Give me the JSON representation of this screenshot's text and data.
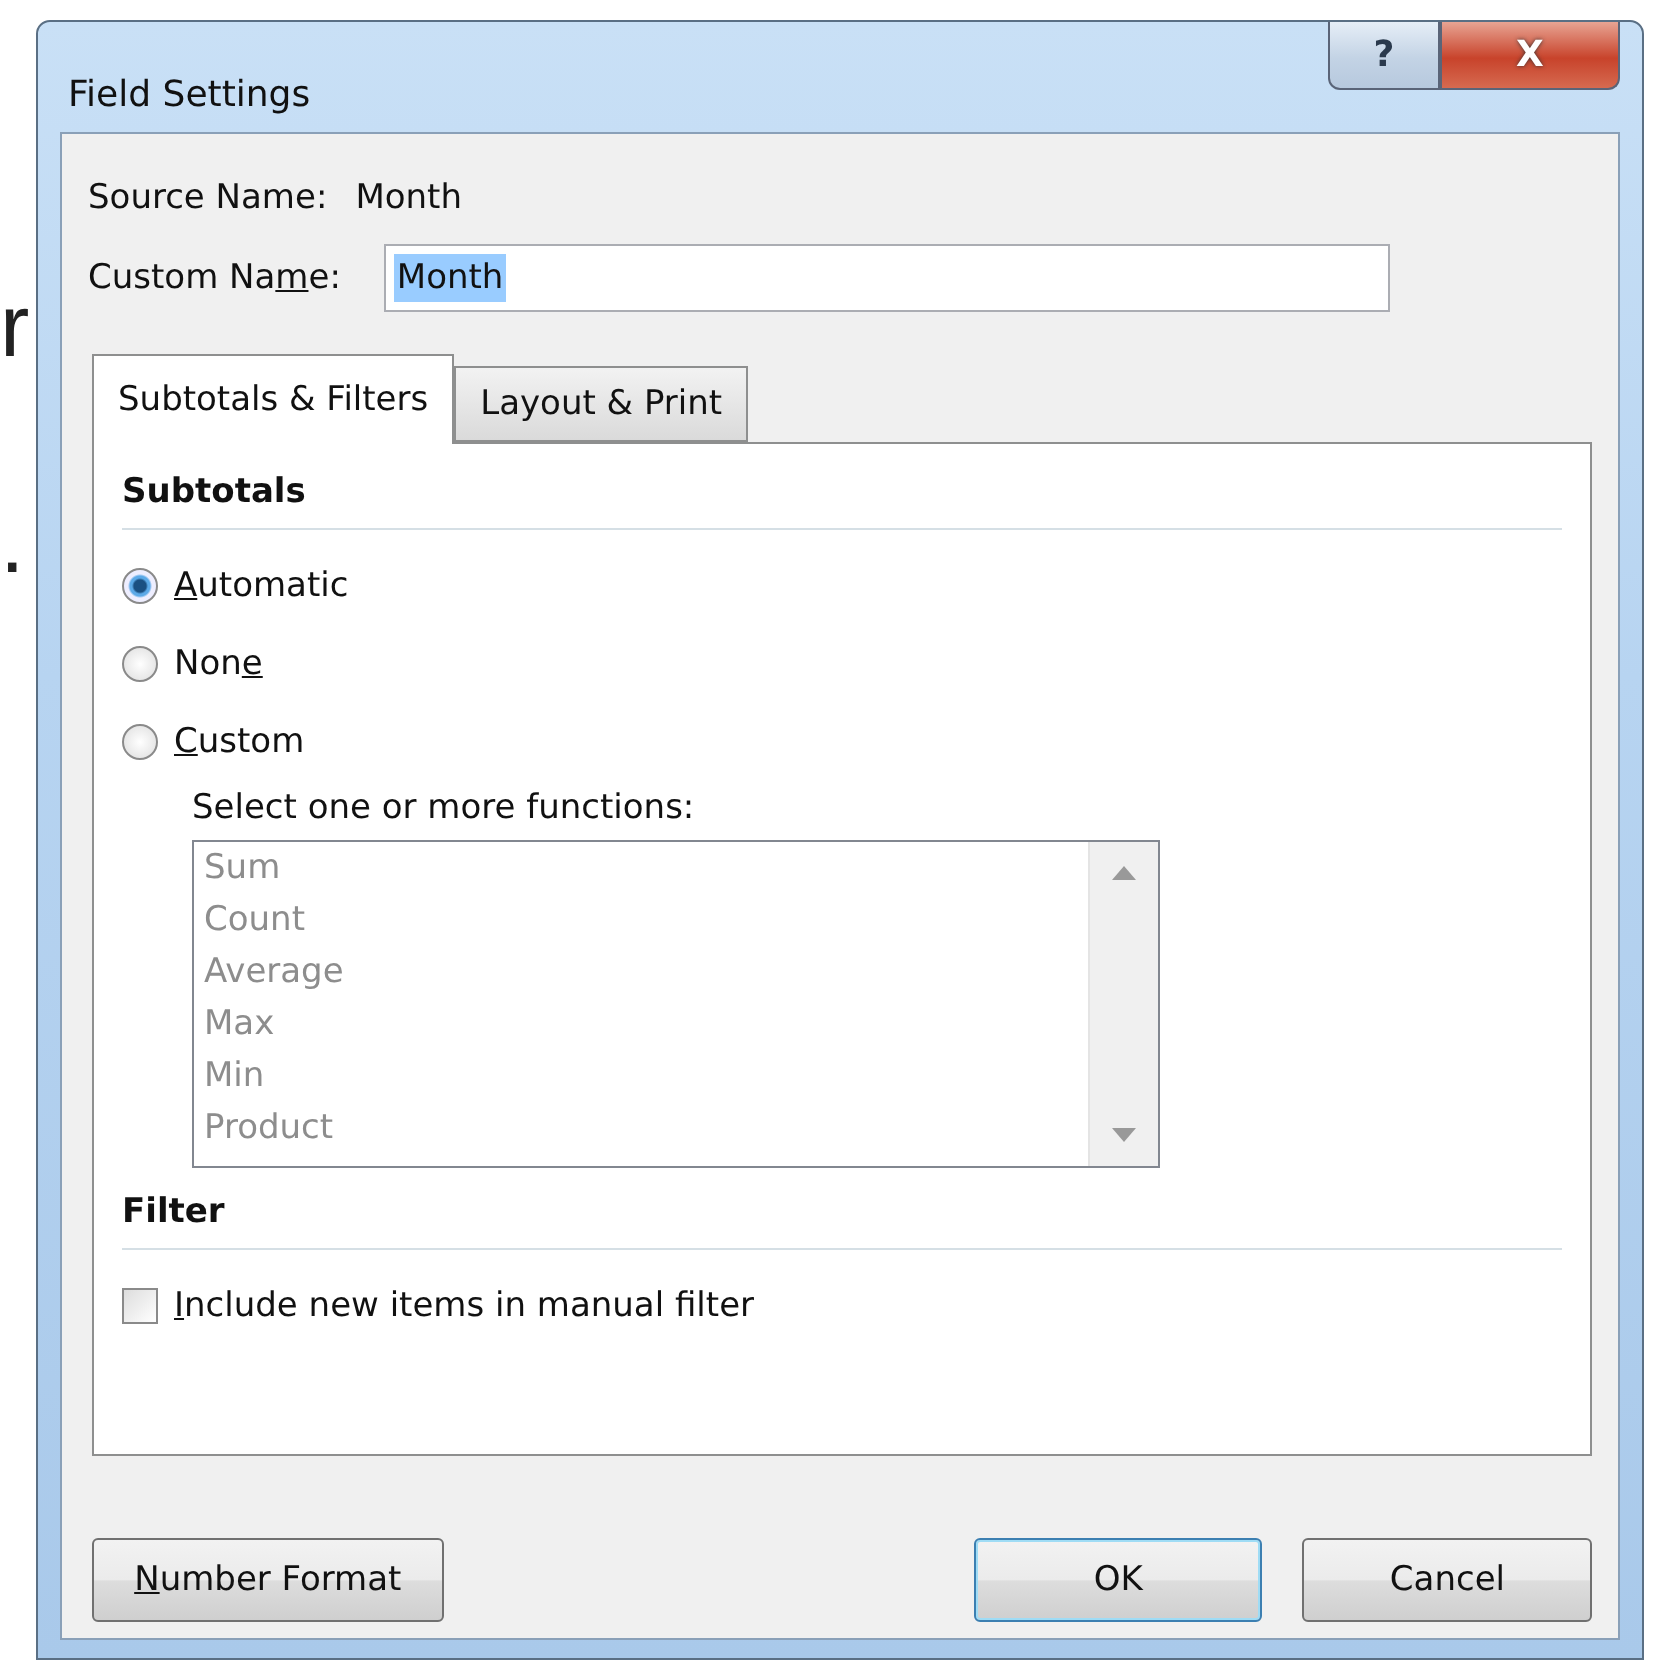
{
  "background_text": [
    "r",
    "."
  ],
  "window": {
    "title": "Field Settings",
    "help_button": "?",
    "close_button": "X"
  },
  "source_name": {
    "label": "Source Name:",
    "value": "Month"
  },
  "custom_name": {
    "label": {
      "before": "Custom Na",
      "key": "m",
      "after": "e:"
    },
    "value": "Month",
    "value_selected": true
  },
  "tabs": [
    {
      "label": "Subtotals & Filters",
      "selected": true
    },
    {
      "label": "Layout & Print",
      "selected": false
    }
  ],
  "subtotals": {
    "heading": "Subtotals",
    "options": [
      {
        "label": {
          "key": "A",
          "after": "utomatic"
        },
        "selected": true
      },
      {
        "label": {
          "before": "Non",
          "key": "e"
        },
        "selected": false
      },
      {
        "label": {
          "key": "C",
          "after": "ustom"
        },
        "selected": false
      }
    ],
    "functions_label": "Select one or more functions:",
    "functions": {
      "disabled": true,
      "items": [
        "Sum",
        "Count",
        "Average",
        "Max",
        "Min",
        "Product"
      ]
    }
  },
  "filter": {
    "heading": "Filter",
    "checkbox": {
      "label": {
        "key": "I",
        "after": "nclude new items in manual filter"
      },
      "checked": false
    }
  },
  "buttons": [
    {
      "label": {
        "key": "N",
        "after": "umber Format"
      },
      "default": false
    },
    {
      "label": {
        "after": "OK"
      },
      "default": true
    },
    {
      "label": {
        "after": "Cancel"
      },
      "default": false
    }
  ]
}
